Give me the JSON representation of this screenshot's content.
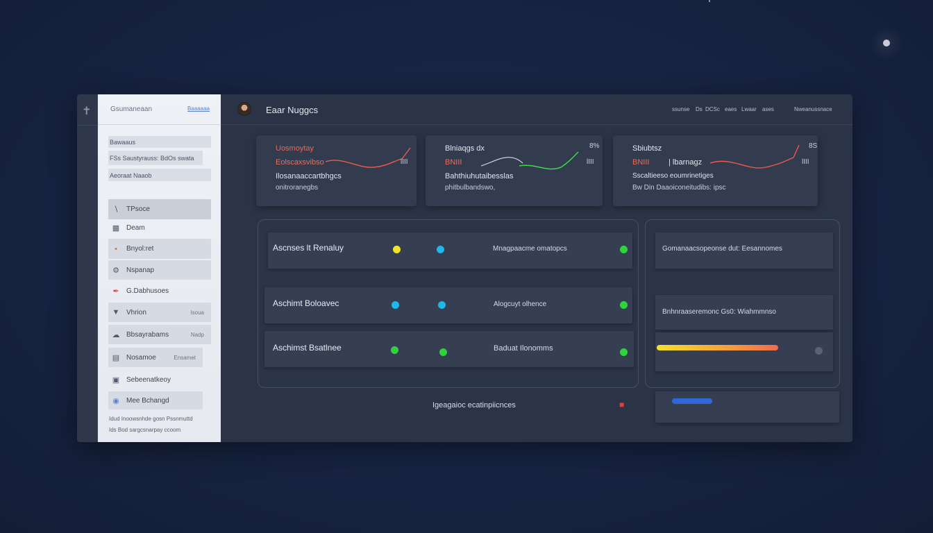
{
  "header": {
    "title": "Eaar Nuggcs",
    "nav": [
      "ssunse",
      "Ds",
      "DCSc",
      "eaes",
      "Lwaar",
      "ases",
      "Nweanussnace"
    ]
  },
  "sidebar": {
    "title": "Gsumaneaan",
    "link": "Baaaaaa",
    "pre_items": [
      "Bawaaus",
      "FSs Saustyrauss: BdOs swata",
      "Aeoraat Naaob"
    ],
    "items": [
      {
        "label": "TPsoce",
        "icon": "menu-icon",
        "trail": ""
      },
      {
        "label": "Deam",
        "icon": "grid-icon",
        "trail": ""
      },
      {
        "label": "Bnyol:ret",
        "icon": "dot-icon",
        "trail": ""
      },
      {
        "label": "Nspanap",
        "icon": "settings-icon",
        "trail": ""
      },
      {
        "label": "G.Dabhusoes",
        "icon": "pen-icon",
        "trail": ""
      },
      {
        "label": "Vhrion",
        "icon": "filter-icon",
        "trail": "Isoua"
      },
      {
        "label": "Bbsayrabams",
        "icon": "cloud-icon",
        "trail": "Nadp"
      },
      {
        "label": "Nosamoe",
        "icon": "document-icon",
        "trail": "Ensamet"
      },
      {
        "label": "Sebeenatkeoy",
        "icon": "archive-icon",
        "trail": ""
      },
      {
        "label": "Mee Bchangd",
        "icon": "tag-icon",
        "trail": ""
      }
    ],
    "footer": [
      "Idud Inoowsnhde gosn Pssnmuttd",
      "Ids Bod sargcsnarpay ccoom"
    ]
  },
  "stats": [
    {
      "label": "Uosmoytay",
      "sub": "Eolscaxsvibso",
      "desc1": "Ilosanaaccartbhgcs",
      "desc2": "onitroranegbs",
      "pct": "",
      "mini": "lIII"
    },
    {
      "label": "Blniaqgs dx",
      "sub": "BNIII",
      "desc1": "Bahthiuhutaibesslas",
      "desc2": "phitbulbandswo,",
      "pct": "8%",
      "mini": "lIII"
    },
    {
      "label": "Sbiubtsz",
      "sub": "BNIII",
      "sub_suffix": "| lbarnagz",
      "desc1": "Sscaltieeso eoumrinetiges",
      "desc2": "Bw Din Daaoiconeitudibs: ipsc",
      "pct": "8S",
      "mini": "lIII"
    }
  ],
  "rows_left": [
    {
      "label": "Ascnses lt Renaluy"
    },
    {
      "label": "Aschimt Boloavec"
    },
    {
      "label": "Aschimst Bsatlnee"
    }
  ],
  "rows_mid": [
    {
      "label": "Mnagpaacme omatopcs"
    },
    {
      "label": "Alogcuyt olhence"
    },
    {
      "label": "Baduat Ilonomms"
    }
  ],
  "rows_right": [
    {
      "label": "Gomanaacsopeonse dut: Eesannomes"
    },
    {
      "label": "Bnhnraaseremonc Gs0: Wiahmmnso"
    }
  ],
  "footer_row": {
    "label": "Igeagaioc ecatinpiicnces"
  },
  "progress": {
    "value": 0.25
  },
  "slider": {
    "value": 0.3
  },
  "colors": {
    "accent_red": "#ef6c59",
    "accent_green": "#2ed43c",
    "accent_cyan": "#1fb8e8",
    "accent_yellow": "#f1e52a"
  }
}
